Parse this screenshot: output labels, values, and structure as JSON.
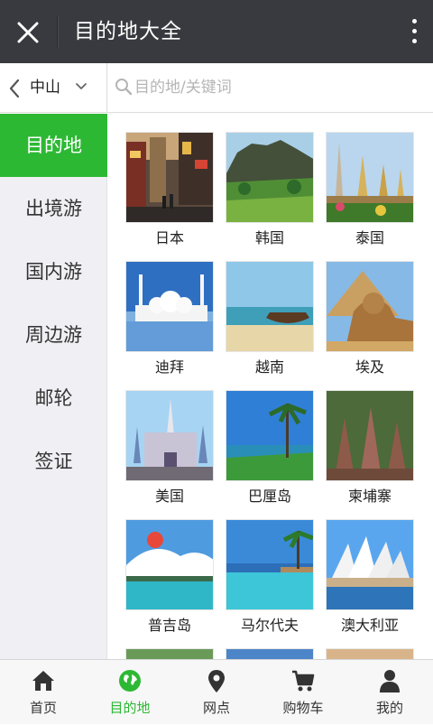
{
  "header": {
    "title": "目的地大全"
  },
  "search": {
    "city": "中山",
    "placeholder": "目的地/关键词"
  },
  "categories": [
    {
      "label": "目的地",
      "active": true
    },
    {
      "label": "出境游",
      "active": false
    },
    {
      "label": "国内游",
      "active": false
    },
    {
      "label": "周边游",
      "active": false
    },
    {
      "label": "邮轮",
      "active": false
    },
    {
      "label": "签证",
      "active": false
    }
  ],
  "destinations": [
    {
      "name": "日本"
    },
    {
      "name": "韩国"
    },
    {
      "name": "泰国"
    },
    {
      "name": "迪拜"
    },
    {
      "name": "越南"
    },
    {
      "name": "埃及"
    },
    {
      "name": "美国"
    },
    {
      "name": "巴厘岛"
    },
    {
      "name": "柬埔寨"
    },
    {
      "name": "普吉岛"
    },
    {
      "name": "马尔代夫"
    },
    {
      "name": "澳大利亚"
    }
  ],
  "tabbar": {
    "items": [
      {
        "label": "首页",
        "icon": "home-icon",
        "active": false
      },
      {
        "label": "目的地",
        "icon": "globe-icon",
        "active": true
      },
      {
        "label": "网点",
        "icon": "location-pin-icon",
        "active": false
      },
      {
        "label": "购物车",
        "icon": "cart-icon",
        "active": false
      },
      {
        "label": "我的",
        "icon": "user-icon",
        "active": false
      }
    ]
  },
  "colors": {
    "accent": "#2db834",
    "header_bg": "#393a3f",
    "sidebar_bg": "#efeff4"
  }
}
